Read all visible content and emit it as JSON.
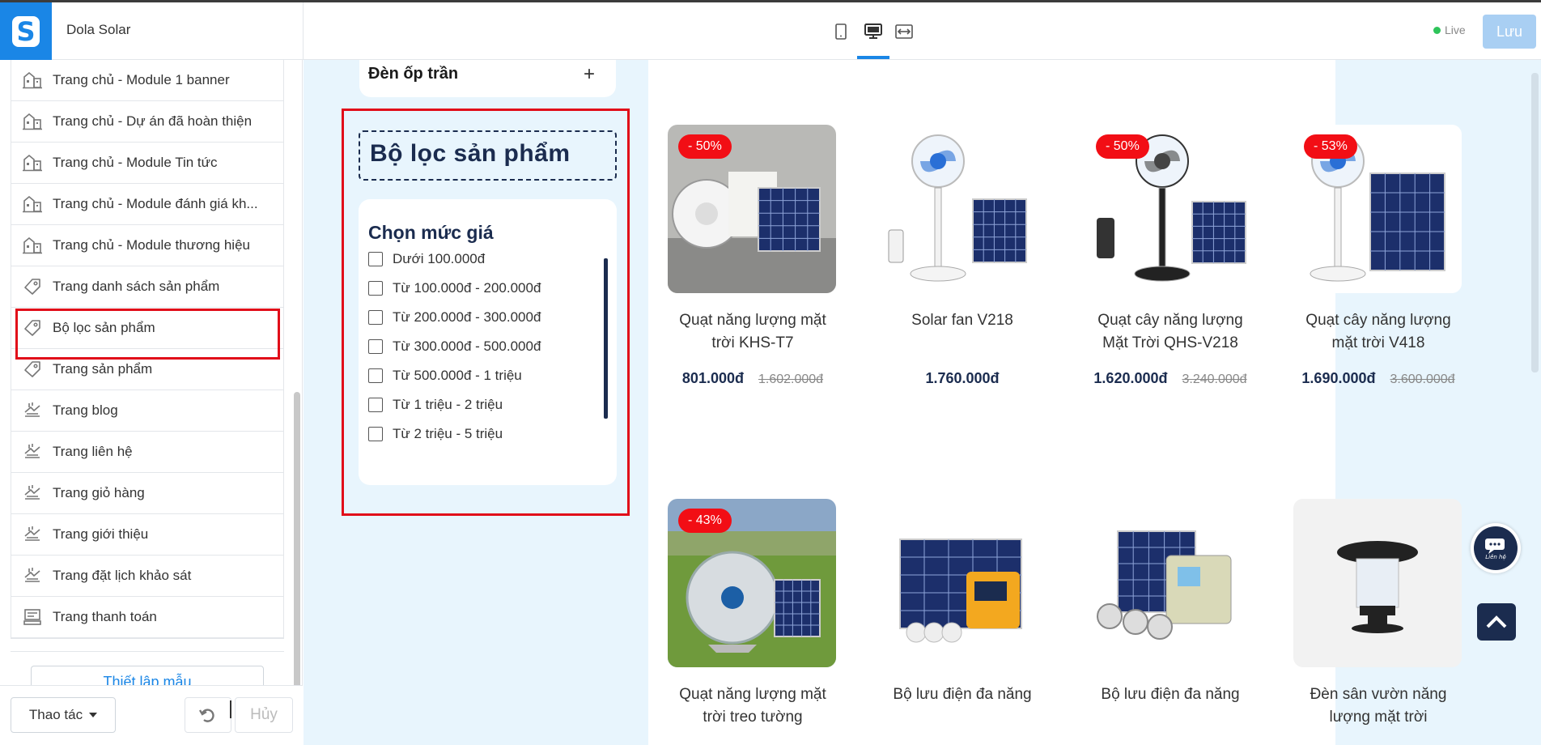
{
  "header": {
    "shop_name": "Dola Solar",
    "live_label": "Live",
    "save_label": "Lưu",
    "logo_letter": "S",
    "devices": [
      "mobile-icon",
      "desktop-icon",
      "fullwidth-icon"
    ],
    "selected_device": "desktop"
  },
  "sidebar": {
    "items": [
      {
        "label": "Trang chủ - Module 1 banner",
        "icon": "home-layout-icon"
      },
      {
        "label": "Trang chủ - Dự án đã hoàn thiện",
        "icon": "home-layout-icon"
      },
      {
        "label": "Trang chủ - Module Tin tức",
        "icon": "home-layout-icon"
      },
      {
        "label": "Trang chủ - Module đánh giá kh...",
        "icon": "home-layout-icon"
      },
      {
        "label": "Trang chủ - Module thương hiệu",
        "icon": "home-layout-icon"
      },
      {
        "label": "Trang danh sách sản phẩm",
        "icon": "tag-icon"
      },
      {
        "label": "Bộ lọc sản phẩm",
        "icon": "tag-icon",
        "selected": true
      },
      {
        "label": "Trang sản phẩm",
        "icon": "tag-icon"
      },
      {
        "label": "Trang blog",
        "icon": "page-icon"
      },
      {
        "label": "Trang liên hệ",
        "icon": "page-icon"
      },
      {
        "label": "Trang giỏ hàng",
        "icon": "page-icon"
      },
      {
        "label": "Trang giới thiệu",
        "icon": "page-icon"
      },
      {
        "label": "Trang đặt lịch khảo sát",
        "icon": "page-icon"
      },
      {
        "label": "Trang thanh toán",
        "icon": "checkout-icon"
      }
    ],
    "template_button": "Thiết lập mẫu",
    "actions_label": "Thao tác",
    "cancel_label": "Hủy"
  },
  "preview": {
    "category_box": {
      "title": "Đèn ốp trần",
      "plus": "+"
    },
    "filter_title": "Bộ lọc sản phẩm",
    "price_filter": {
      "heading": "Chọn mức giá",
      "options": [
        "Dưới 100.000đ",
        "Từ 100.000đ - 200.000đ",
        "Từ 200.000đ - 300.000đ",
        "Từ 300.000đ - 500.000đ",
        "Từ 500.000đ - 1 triệu",
        "Từ 1 triệu - 2 triệu",
        "Từ 2 triệu - 5 triệu"
      ]
    },
    "products": [
      {
        "name_l1": "Quạt năng lượng mặt",
        "name_l2": "trời KHS-T7",
        "price": "801.000đ",
        "old_price": "1.602.000đ",
        "badge": "- 50%",
        "image": "fan-with-panel"
      },
      {
        "name_l1": "Solar fan V218",
        "name_l2": "",
        "price": "1.760.000đ",
        "old_price": "",
        "badge": "",
        "image": "stand-fan-panel"
      },
      {
        "name_l1": "Quạt cây năng lượng",
        "name_l2": "Mặt Trời QHS-V218",
        "price": "1.620.000đ",
        "old_price": "3.240.000đ",
        "badge": "- 50%",
        "image": "black-stand-fan"
      },
      {
        "name_l1": "Quạt cây năng lượng",
        "name_l2": "mặt trời V418",
        "price": "1.690.000đ",
        "old_price": "3.600.000đ",
        "badge": "- 53%",
        "image": "blue-stand-fan"
      },
      {
        "name_l1": "Quạt năng lượng mặt",
        "name_l2": "trời treo tường",
        "price": "",
        "old_price": "",
        "badge": "- 43%",
        "image": "floor-fan-grass"
      },
      {
        "name_l1": "Bộ lưu điện đa năng",
        "name_l2": "",
        "price": "",
        "old_price": "",
        "badge": "",
        "image": "solar-kit-yellow"
      },
      {
        "name_l1": "Bộ lưu điện đa năng",
        "name_l2": "",
        "price": "",
        "old_price": "",
        "badge": "",
        "image": "solar-kit-green"
      },
      {
        "name_l1": "Đèn sân vườn năng",
        "name_l2": "lượng mặt trời",
        "price": "",
        "old_price": "",
        "badge": "",
        "image": "garden-lamp"
      }
    ],
    "contact_button": "Liên hệ"
  },
  "colors": {
    "accent": "#1a86e6",
    "navy": "#1b2c4f",
    "badge_red": "#f20e15",
    "selection_red": "#e10d19",
    "canvas_bg": "#e8f5fd"
  }
}
